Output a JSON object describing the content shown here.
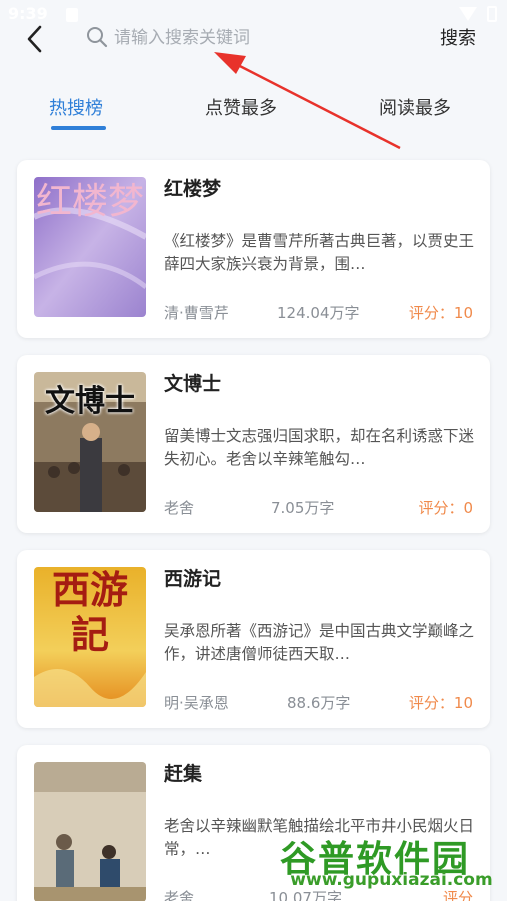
{
  "status_bar": {
    "time": "9:39"
  },
  "header": {
    "search_placeholder": "请输入搜索关键词",
    "search_button": "搜索"
  },
  "tabs": [
    {
      "label": "热搜榜",
      "active": true
    },
    {
      "label": "点赞最多",
      "active": false
    },
    {
      "label": "阅读最多",
      "active": false
    }
  ],
  "books": [
    {
      "title": "红楼梦",
      "cover_text": "红楼梦",
      "description": "《红楼梦》是曹雪芹所著古典巨著，以贾史王薛四大家族兴衰为背景，围…",
      "author": "清·曹雪芹",
      "words": "124.04万字",
      "score": "评分：10"
    },
    {
      "title": "文博士",
      "cover_text": "文博士",
      "description": "留美博士文志强归国求职，却在名利诱惑下迷失初心。老舍以辛辣笔触勾…",
      "author": "老舍",
      "words": "7.05万字",
      "score": "评分：0"
    },
    {
      "title": "西游记",
      "cover_text": "西游記",
      "description": "吴承恩所著《西游记》是中国古典文学巅峰之作，讲述唐僧师徒西天取…",
      "author": "明·吴承恩",
      "words": "88.6万字",
      "score": "评分：10"
    },
    {
      "title": "赶集",
      "cover_text": "",
      "description": "老舍以辛辣幽默笔触描绘北平市井小民烟火日常，…",
      "author": "老舍",
      "words": "10.07万字",
      "score": "评分"
    }
  ],
  "watermark": {
    "brand": "谷普软件园",
    "url": "www.gupuxiazai.com"
  },
  "colors": {
    "accent": "#2f7fd8",
    "score": "#f08a4b",
    "annotation_arrow": "#e8322b"
  }
}
